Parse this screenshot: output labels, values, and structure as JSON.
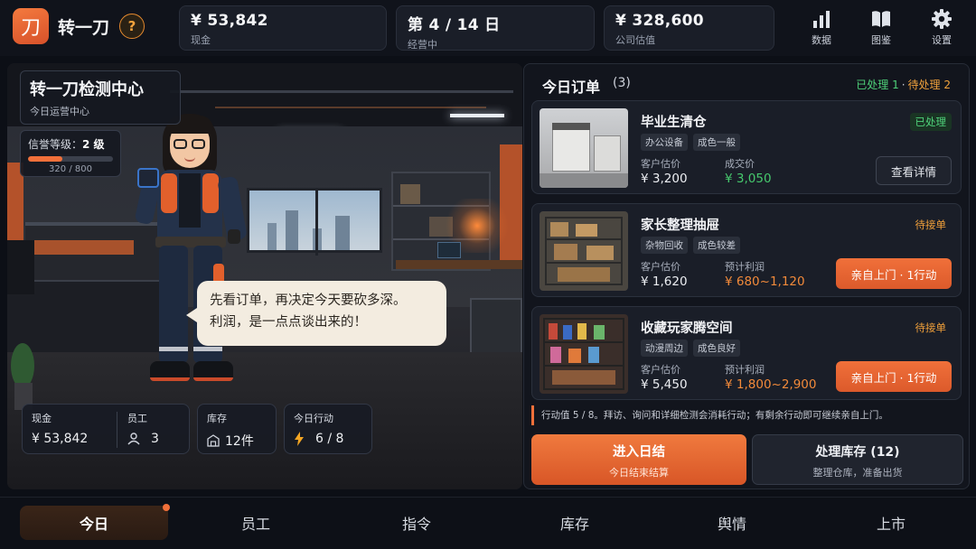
{
  "app": {
    "logo_char": "刀",
    "name": "转一刀",
    "help": "?"
  },
  "stats": {
    "cash": {
      "value": "¥ 53,842",
      "label": "现金"
    },
    "day": {
      "value": "第 4 / 14 日",
      "label": "经营中"
    },
    "valuation": {
      "value": "¥ 328,600",
      "label": "公司估值"
    }
  },
  "top_actions": [
    {
      "label": "数据",
      "icon": "bar-chart-icon"
    },
    {
      "label": "图鉴",
      "icon": "book-icon"
    },
    {
      "label": "设置",
      "icon": "gear-icon"
    }
  ],
  "hq": {
    "title": "转一刀检测中心",
    "subtitle": "今日运营中心"
  },
  "reputation": {
    "label": "信誉等级：",
    "level": "2 级",
    "current": 320,
    "max": 800,
    "count_text": "320 / 800",
    "progress": 0.4
  },
  "speech": {
    "line1": "先看订单，再决定今天要砍多深。",
    "line2": "利润，是一点点谈出来的！"
  },
  "summary": {
    "cash_label": "现金",
    "cash_value": "¥ 53,842",
    "staff_label": "员工",
    "staff_value": "3",
    "stock_label": "库存",
    "stock_value": "12件",
    "action_label": "今日行动",
    "action_value": "6 / 8"
  },
  "orders": {
    "title": "今日订单",
    "count": "(3)",
    "done_text": "已处理 1",
    "dot": "·",
    "pending_text": "待处理 2",
    "items": [
      {
        "name": "毕业生清仓",
        "tags": [
          "办公设备",
          "成色一般"
        ],
        "status": "已处理",
        "label1": "客户估价",
        "value1": "¥ 3,200",
        "label2": "成交价",
        "value2": "¥ 3,050",
        "button": "查看详情"
      },
      {
        "name": "家长整理抽屉",
        "tags": [
          "杂物回收",
          "成色较差"
        ],
        "status": "待接单",
        "label1": "客户估价",
        "value1": "¥ 1,620",
        "label2": "预计利润",
        "value2": "¥ 680~1,120",
        "button": "亲自上门 · 1行动"
      },
      {
        "name": "收藏玩家腾空间",
        "tags": [
          "动漫周边",
          "成色良好"
        ],
        "status": "待接单",
        "label1": "客户估价",
        "value1": "¥ 5,450",
        "label2": "预计利润",
        "value2": "¥ 1,800~2,900",
        "button": "亲自上门 · 1行动"
      }
    ],
    "note": "行动值 5 / 8。拜访、询问和详细检测会消耗行动；有剩余行动即可继续亲自上门。",
    "end_day": {
      "title": "进入日结",
      "sub": "今日结束结算"
    },
    "inventory": {
      "title": "处理库存  (12)",
      "sub": "整理仓库，准备出货"
    }
  },
  "nav": [
    "今日",
    "员工",
    "指令",
    "库存",
    "舆情",
    "上市"
  ],
  "colors": {
    "accent": "#f1703a",
    "success": "#4fd27a",
    "pending": "#f3a13a",
    "bg": "#0c0f16"
  }
}
